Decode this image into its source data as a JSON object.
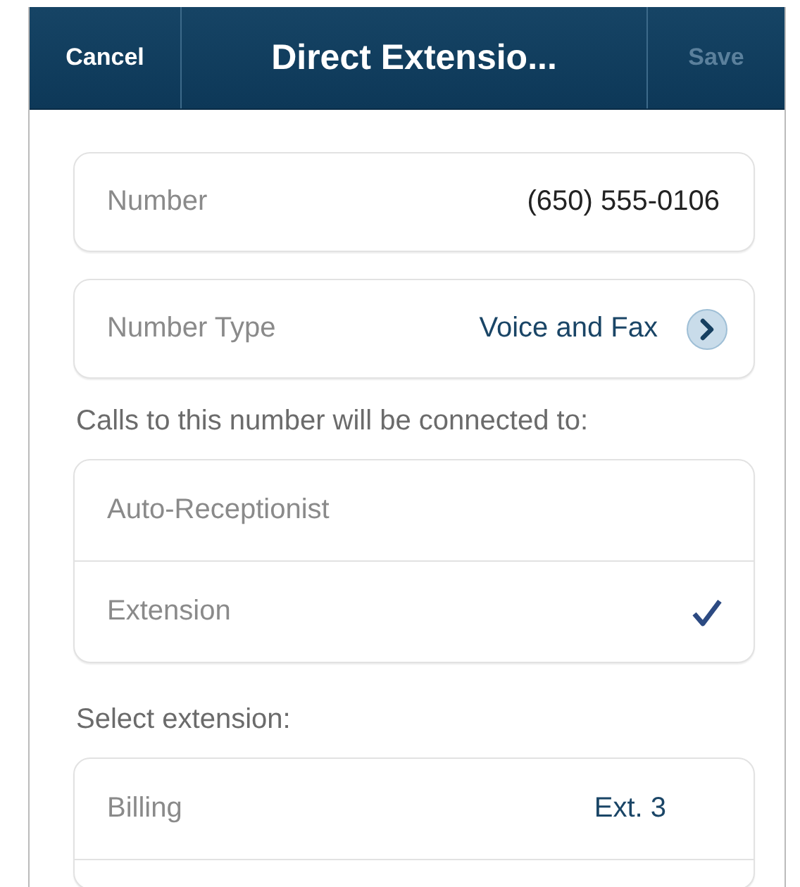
{
  "nav_bar": {
    "cancel": "Cancel",
    "title": "Direct Extensio...",
    "save": {
      "label": "Save",
      "disabled": true
    }
  },
  "fields": [
    {
      "kind": "value",
      "label": "Number",
      "value": "(650) 555-0106"
    },
    {
      "kind": "disclosure",
      "label": "Number Type",
      "value": "Voice and Fax"
    }
  ],
  "connect_label": "Calls to this number will be connected to:",
  "destinations": [
    {
      "label": "Auto-Receptionist",
      "selected": false
    },
    {
      "label": "Extension",
      "selected": true
    }
  ],
  "select_label": "Select extension:",
  "extensions": [
    {
      "name": "Billing",
      "extension": "Ext. 3"
    }
  ]
}
